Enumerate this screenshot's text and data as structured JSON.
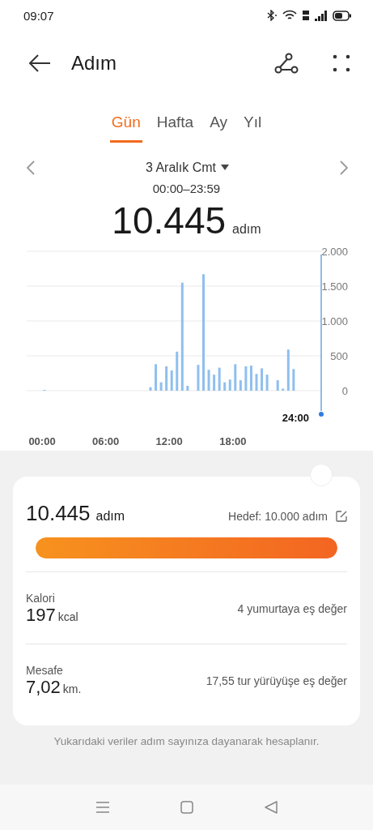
{
  "status_bar": {
    "time": "09:07"
  },
  "header": {
    "title": "Adım"
  },
  "tabs": [
    {
      "label": "Gün",
      "selected": true
    },
    {
      "label": "Hafta",
      "selected": false
    },
    {
      "label": "Ay",
      "selected": false
    },
    {
      "label": "Yıl",
      "selected": false
    }
  ],
  "date_nav": {
    "date": "3 Aralık Cmt",
    "range": "00:00–23:59",
    "total": "10.445",
    "unit": "adım"
  },
  "chart": {
    "cursor_label": "24:00",
    "chart_data": {
      "type": "bar",
      "categories": [
        "00:00",
        null,
        null,
        null,
        null,
        null,
        null,
        null,
        null,
        null,
        null,
        null,
        "06:00",
        null,
        null,
        null,
        null,
        null,
        null,
        null,
        null,
        null,
        null,
        null,
        "12:00",
        null,
        null,
        null,
        null,
        null,
        null,
        null,
        null,
        null,
        null,
        null,
        "18:00",
        null,
        null,
        null,
        null,
        null,
        null,
        null,
        null,
        null,
        null,
        null
      ],
      "series": [
        {
          "color": "#8fbfee",
          "values": [
            10,
            0,
            0,
            0,
            0,
            0,
            0,
            0,
            0,
            0,
            0,
            0,
            0,
            0,
            0,
            0,
            0,
            0,
            0,
            0,
            50,
            380,
            120,
            350,
            290,
            560,
            1550,
            70,
            0,
            370,
            1670,
            300,
            230,
            330,
            120,
            160,
            380,
            150,
            350,
            360,
            240,
            320,
            230,
            0,
            150,
            30,
            590,
            310
          ]
        }
      ],
      "ylim": [
        0,
        2000
      ],
      "grid": true,
      "yticks": [
        {
          "value": 0,
          "label": "0"
        },
        {
          "value": 500,
          "label": "500"
        },
        {
          "value": 1000,
          "label": "1.000"
        },
        {
          "value": 1500,
          "label": "1.500"
        },
        {
          "value": 2000,
          "label": "2.000"
        }
      ]
    }
  },
  "summary": {
    "steps": "10.445",
    "unit": "adım",
    "goal": "Hedef: 10.000 adım",
    "level": 1,
    "stats": [
      {
        "label": "Kalori",
        "value": "197",
        "unit": "kcal",
        "note": "4 yumurtaya eş değer"
      },
      {
        "label": "Mesafe",
        "value": "7,02",
        "unit": "km.",
        "note": "17,55 tur yürüyüşe eş değer"
      }
    ]
  },
  "footnote": "Yukarıdaki veriler adım sayınıza dayanarak hesaplanır."
}
